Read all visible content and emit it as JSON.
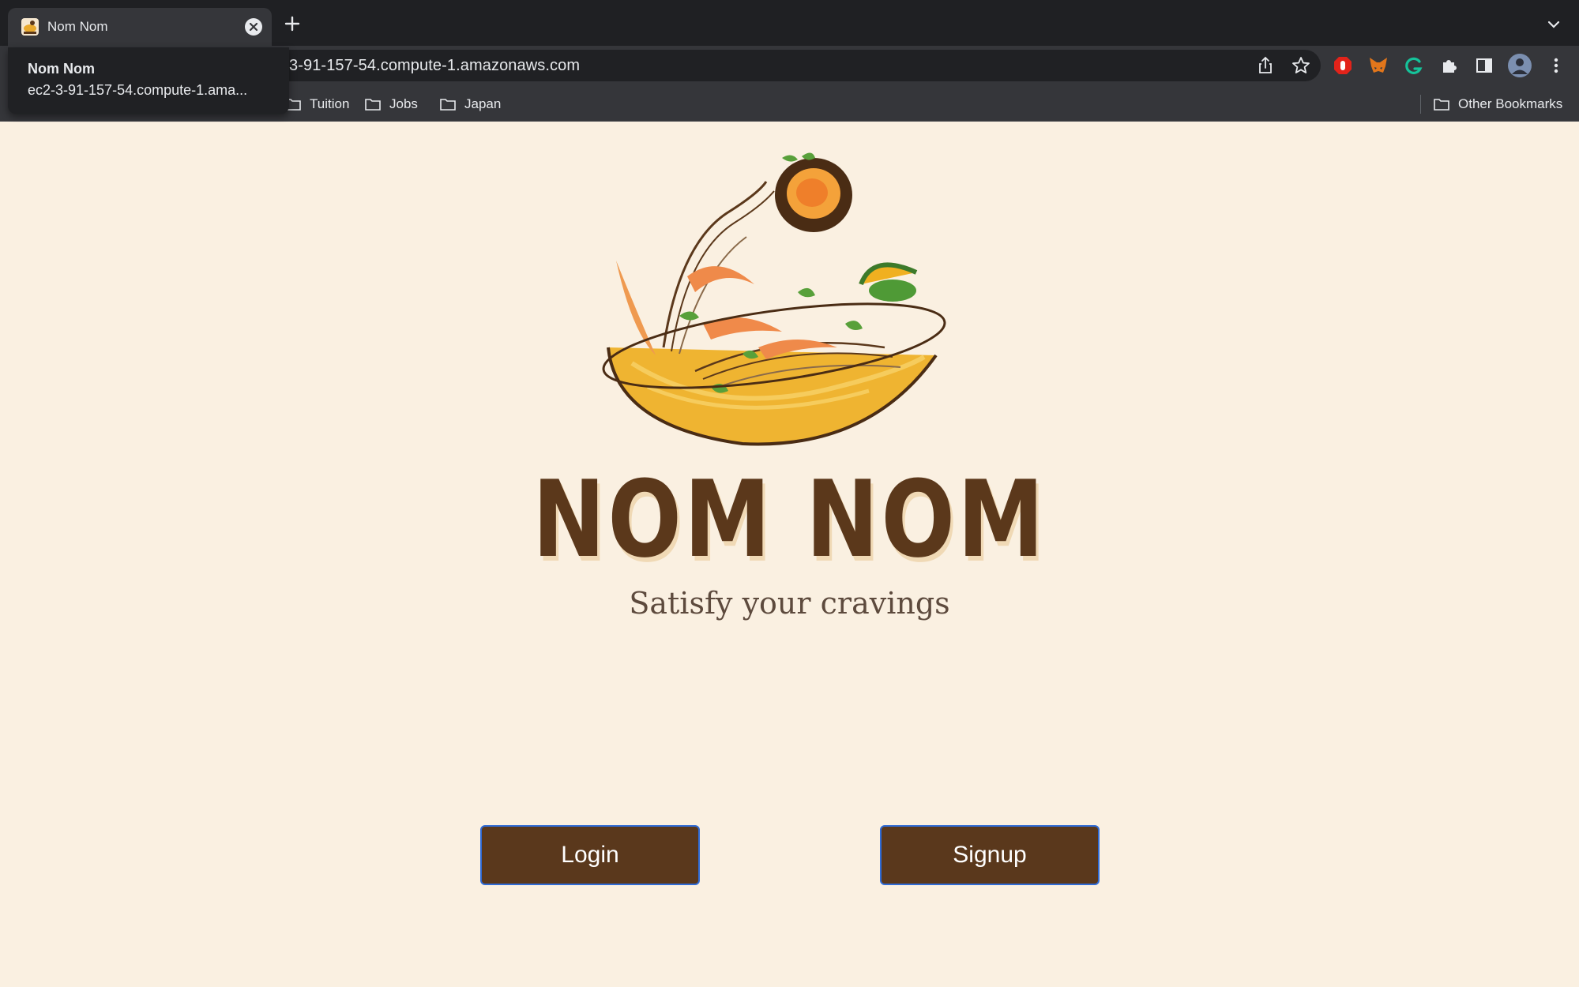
{
  "browser": {
    "tab": {
      "title": "Nom Nom"
    },
    "address_bar": {
      "url": "3-91-157-54.compute-1.amazonaws.com"
    },
    "tooltip": {
      "title": "Nom Nom",
      "url": "ec2-3-91-157-54.compute-1.ama..."
    },
    "bookmarks": [
      {
        "label": "Tuition"
      },
      {
        "label": "Jobs"
      },
      {
        "label": "Japan"
      }
    ],
    "other_bookmarks": "Other Bookmarks",
    "icons": [
      "share-icon",
      "star-icon",
      "adblock-icon",
      "metamask-icon",
      "grammarly-icon",
      "extensions-icon",
      "side-panel-icon",
      "profile-avatar",
      "menu-icon"
    ]
  },
  "page": {
    "brand": "NOM NOM",
    "tagline": "Satisfy your cravings",
    "login_label": "Login",
    "signup_label": "Signup"
  },
  "colors": {
    "page_background": "#faf0e1",
    "brand_brown": "#5b381b",
    "button_fill": "#5a381c",
    "button_border": "#2f6bd6"
  }
}
